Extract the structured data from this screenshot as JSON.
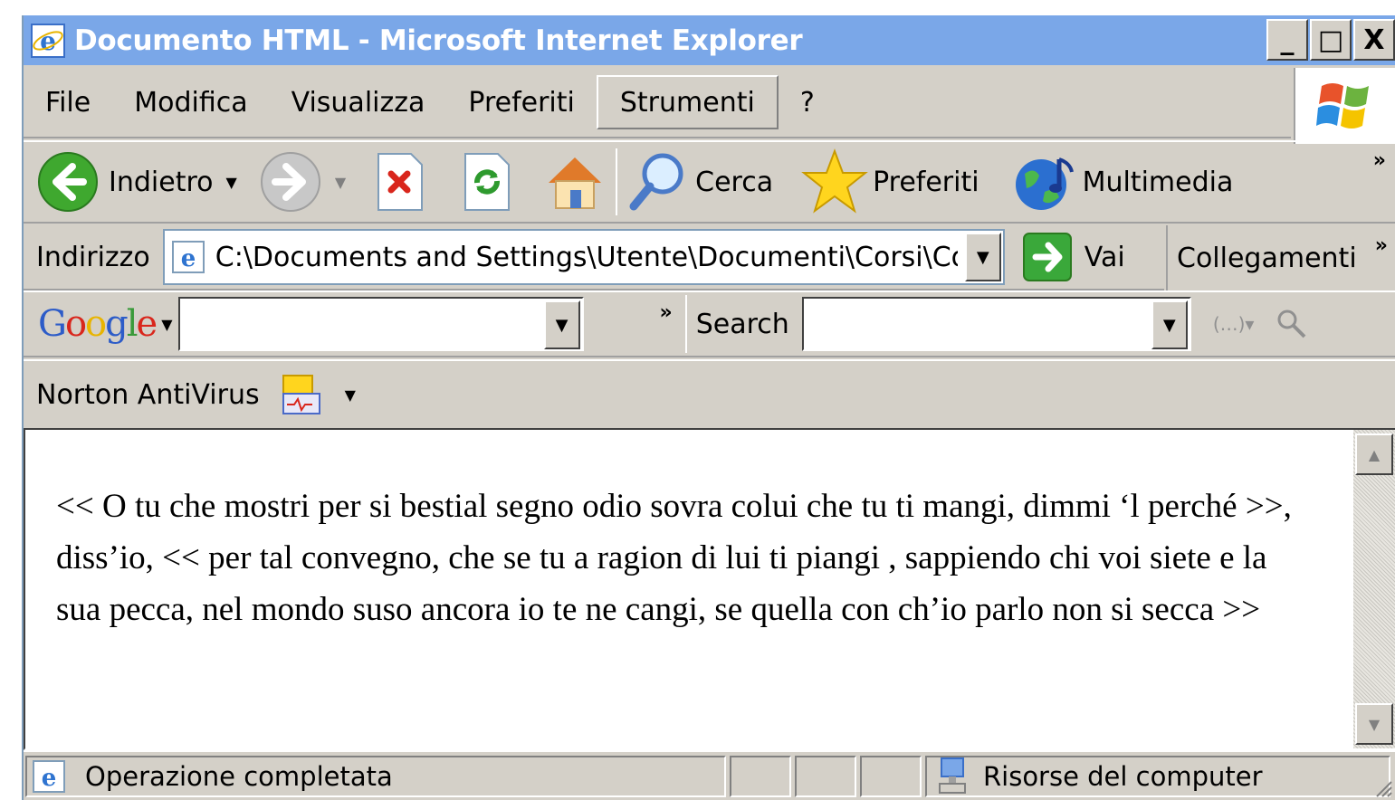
{
  "window": {
    "title": "Documento HTML - Microsoft Internet Explorer",
    "controls": {
      "minimize": "_",
      "maximize": "□",
      "close": "X"
    }
  },
  "menu": {
    "items": [
      {
        "label": "File"
      },
      {
        "label": "Modifica"
      },
      {
        "label": "Visualizza"
      },
      {
        "label": "Preferiti"
      },
      {
        "label": "Strumenti",
        "active": true
      },
      {
        "label": "?"
      }
    ]
  },
  "toolbar": {
    "back_label": "Indietro",
    "search_label": "Cerca",
    "favorites_label": "Preferiti",
    "media_label": "Multimedia",
    "overflow": "»"
  },
  "address": {
    "label": "Indirizzo",
    "value": "C:\\Documents and Settings\\Utente\\Documenti\\Corsi\\Co",
    "go_label": "Vai",
    "links_label": "Collegamenti",
    "links_overflow": "»"
  },
  "google": {
    "logo": "Google",
    "query": "",
    "overflow": "»",
    "search_label": "Search",
    "search_value": ""
  },
  "norton": {
    "label": "Norton AntiVirus"
  },
  "content": {
    "text": "<< O tu che mostri per si bestial segno odio sovra colui che tu ti mangi, dimmi ‘l perché >>, diss’io, << per tal convegno, che se tu a ragion di lui ti piangi , sappiendo chi voi siete e la sua pecca, nel mondo suso ancora io te ne cangi, se quella con ch’io parlo non si secca >>"
  },
  "status": {
    "message": "Operazione completata",
    "zone": "Risorse del computer"
  },
  "colors": {
    "titlebar": "#7aa7e8",
    "chrome": "#d4d0c8"
  }
}
